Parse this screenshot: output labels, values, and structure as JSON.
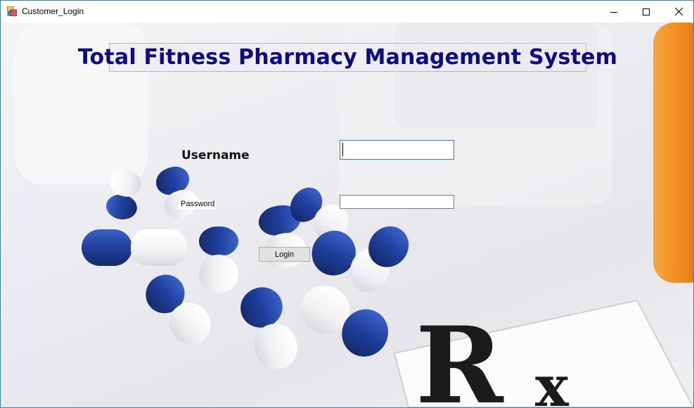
{
  "window": {
    "title": "Customer_Login",
    "controls": [
      "minimize-icon",
      "maximize-icon",
      "close-icon"
    ]
  },
  "header": {
    "title": "Total Fitness Pharmacy Management System"
  },
  "form": {
    "username_label": "Username",
    "username_value": "",
    "password_label": "Password",
    "password_value": "",
    "login_label": "Login"
  },
  "background": {
    "image": "blue-and-white-capsules-with-prescription-symbol",
    "colors": {
      "capsule_blue": "#1f3f9c",
      "capsule_white": "#f7f7f7",
      "bottle_orange": "#f08a1c",
      "title_navy": "#0b0b8a"
    }
  }
}
